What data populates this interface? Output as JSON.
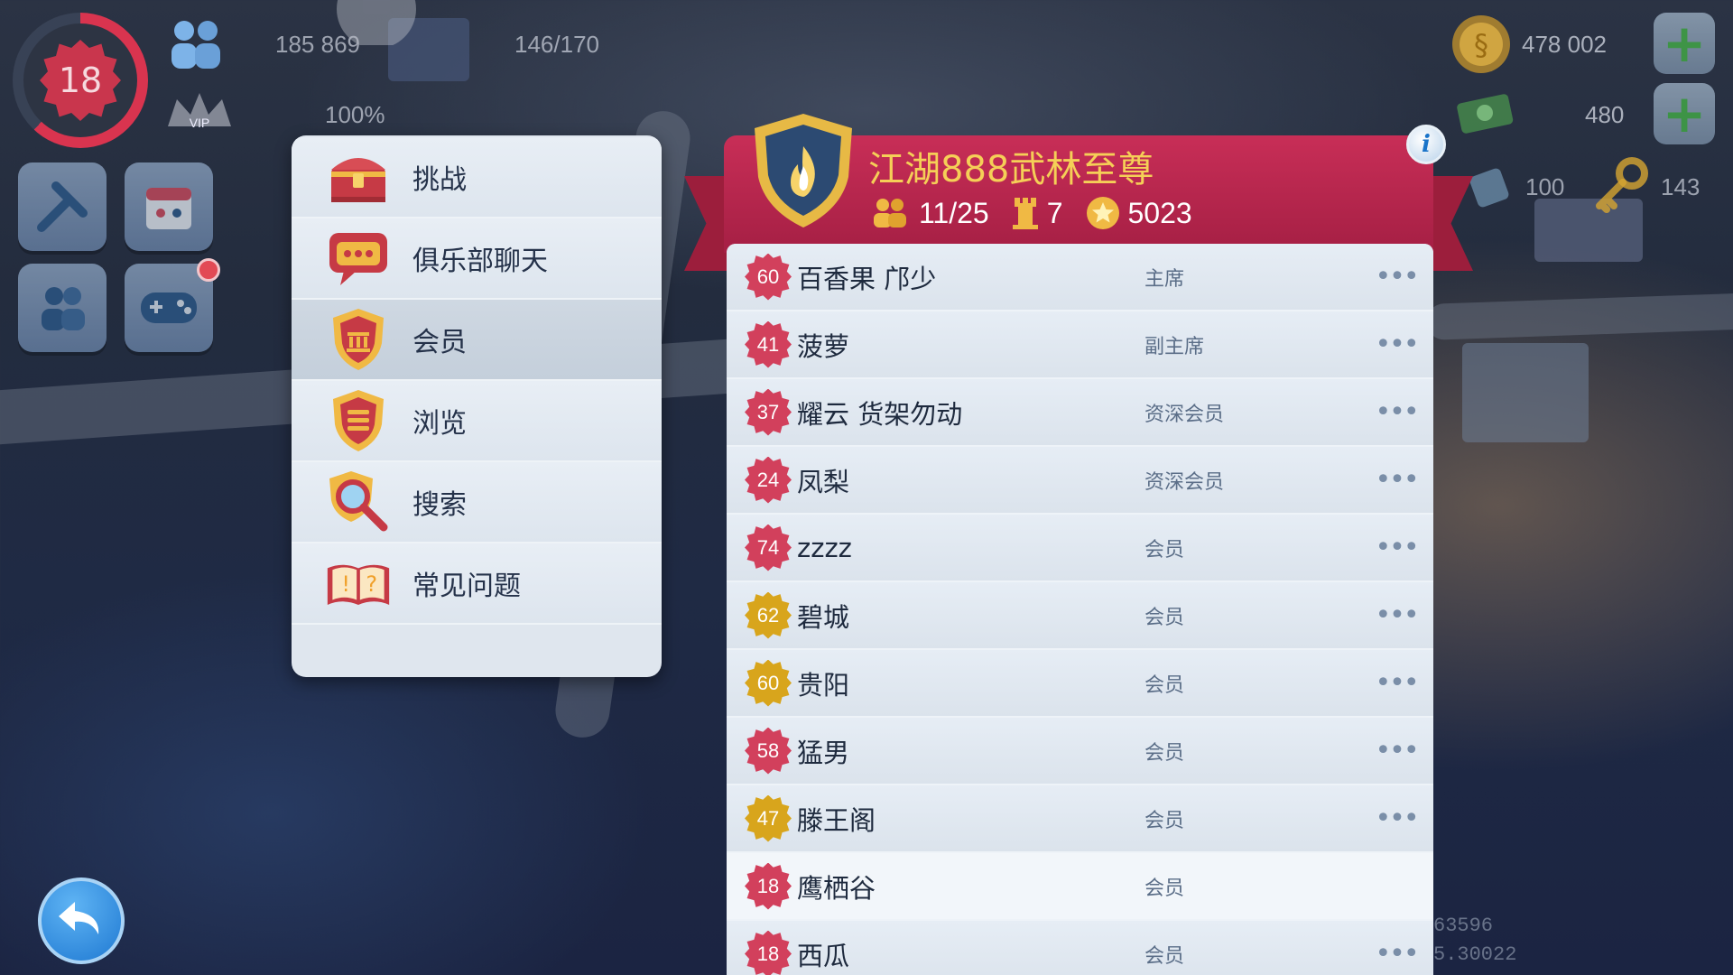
{
  "hud": {
    "level": "18",
    "population": "185 869",
    "population_pct": "100%",
    "capacity": "146/170",
    "simoleons": "478 002",
    "simcash": "480",
    "resource_a": "100",
    "keys": "143"
  },
  "menu": {
    "items": [
      {
        "label": "挑战",
        "icon": "treasure-chest-icon"
      },
      {
        "label": "俱乐部聊天",
        "icon": "chat-bubble-icon"
      },
      {
        "label": "会员",
        "icon": "member-shield-icon"
      },
      {
        "label": "浏览",
        "icon": "browse-shield-icon"
      },
      {
        "label": "搜索",
        "icon": "search-icon"
      },
      {
        "label": "常见问题",
        "icon": "faq-book-icon"
      }
    ],
    "active_index": 2
  },
  "club": {
    "name": "江湖888武林至尊",
    "members": "11/25",
    "trophies": "7",
    "points": "5023"
  },
  "members": [
    {
      "level": "60",
      "name": "百香果 邝少",
      "role": "主席",
      "badge": "red",
      "more": "•••"
    },
    {
      "level": "41",
      "name": "菠萝",
      "role": "副主席",
      "badge": "red",
      "more": "•••"
    },
    {
      "level": "37",
      "name": "耀云 货架勿动",
      "role": "资深会员",
      "badge": "red",
      "more": "•••"
    },
    {
      "level": "24",
      "name": "凤梨",
      "role": "资深会员",
      "badge": "red",
      "more": "•••"
    },
    {
      "level": "74",
      "name": "zzzz",
      "role": "会员",
      "badge": "red",
      "more": "•••"
    },
    {
      "level": "62",
      "name": "碧城",
      "role": "会员",
      "badge": "gold",
      "more": "•••"
    },
    {
      "level": "60",
      "name": "贵阳",
      "role": "会员",
      "badge": "gold",
      "more": "•••"
    },
    {
      "level": "58",
      "name": "猛男",
      "role": "会员",
      "badge": "red",
      "more": "•••"
    },
    {
      "level": "47",
      "name": "滕王阁",
      "role": "会员",
      "badge": "gold",
      "more": "•••"
    },
    {
      "level": "18",
      "name": "鹰栖谷",
      "role": "会员",
      "badge": "red",
      "more": "",
      "highlight": true
    },
    {
      "level": "18",
      "name": "西瓜",
      "role": "会员",
      "badge": "red",
      "more": "•••"
    }
  ],
  "footer": {
    "coord_1": "63596",
    "coord_2": "5.30022"
  },
  "colors": {
    "club_header": "#b8264c",
    "club_name": "#f5cf57",
    "panel_bg": "#dde5ee"
  }
}
